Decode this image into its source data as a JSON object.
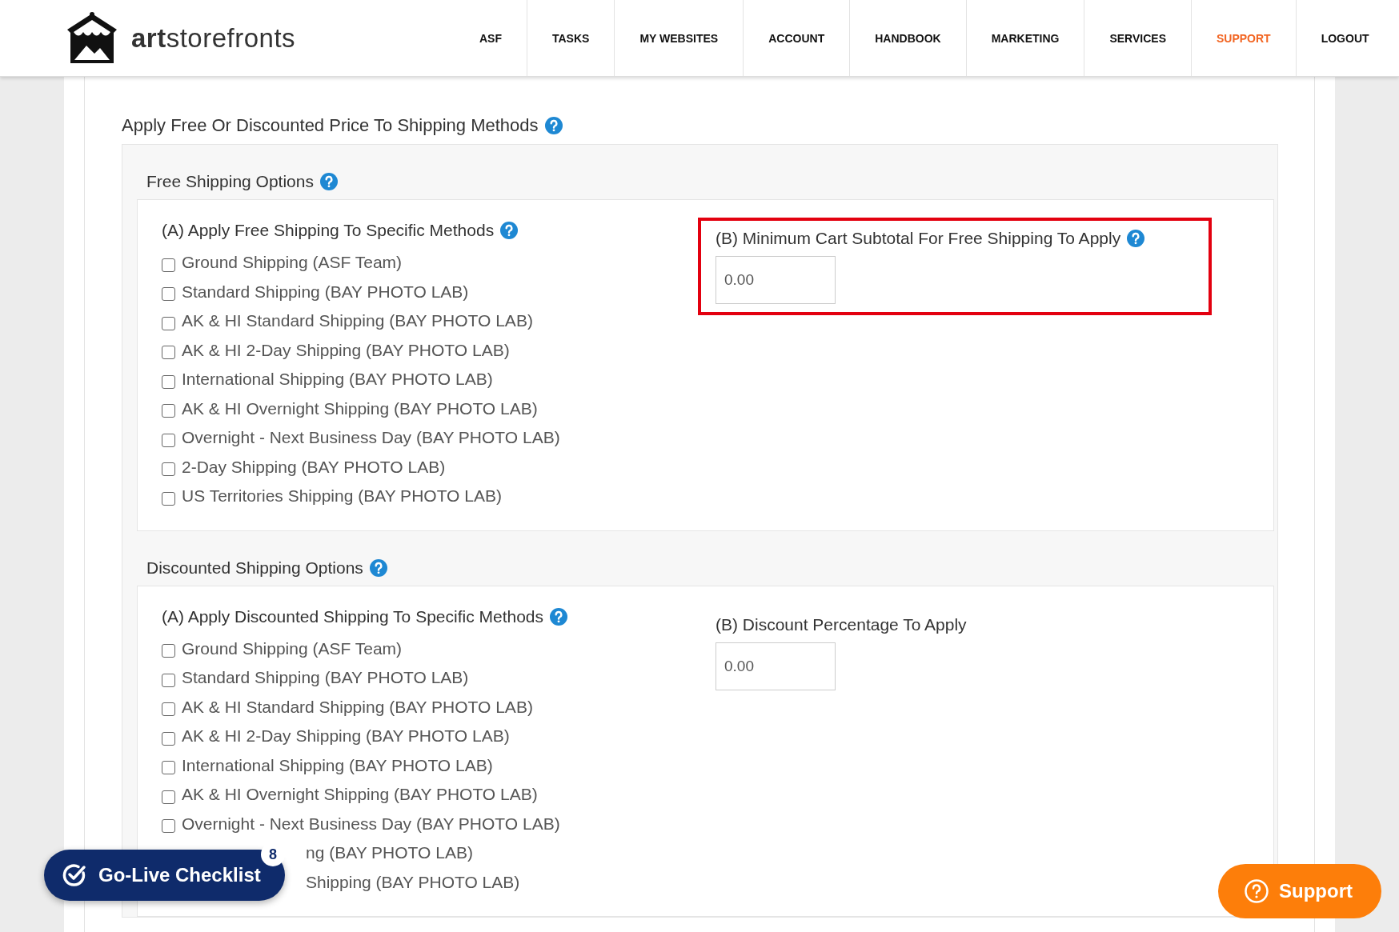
{
  "header": {
    "logo": "**art**storefronts",
    "nav": [
      {
        "label": "ASF",
        "selected": false
      },
      {
        "label": "TASKS",
        "selected": false
      },
      {
        "label": "MY WEBSITES",
        "selected": false
      },
      {
        "label": "ACCOUNT",
        "selected": false
      },
      {
        "label": "HANDBOOK",
        "selected": false
      },
      {
        "label": "MARKETING",
        "selected": false
      },
      {
        "label": "SERVICES",
        "selected": false
      },
      {
        "label": "SUPPORT",
        "selected": true
      },
      {
        "label": "LOGOUT",
        "selected": false
      }
    ]
  },
  "page_title": {
    "text": "Apply Free Or Discounted Price To Shipping Methods",
    "help": true
  },
  "sections": [
    {
      "title": "Free Shipping Options",
      "help": true,
      "column_a": {
        "title": "(A) Apply Free Shipping To Specific Methods",
        "help": true,
        "options": [
          {
            "label": "Ground Shipping (ASF Team)",
            "checked": false
          },
          {
            "label": "Standard Shipping (BAY PHOTO LAB)",
            "checked": false
          },
          {
            "label": "AK & HI Standard Shipping (BAY PHOTO LAB)",
            "checked": false
          },
          {
            "label": "AK & HI 2-Day Shipping (BAY PHOTO LAB)",
            "checked": false
          },
          {
            "label": "International Shipping (BAY PHOTO LAB)",
            "checked": false
          },
          {
            "label": "AK & HI Overnight Shipping (BAY PHOTO LAB)",
            "checked": false
          },
          {
            "label": "Overnight - Next Business Day (BAY PHOTO LAB)",
            "checked": false
          },
          {
            "label": "2-Day Shipping (BAY PHOTO LAB)",
            "checked": false
          },
          {
            "label": "US Territories Shipping (BAY PHOTO LAB)",
            "checked": false
          }
        ]
      },
      "column_b": {
        "title": "(B) Minimum Cart Subtotal For Free Shipping To Apply",
        "help": true,
        "value": "0.00",
        "highlighted": true
      }
    },
    {
      "title": "Discounted Shipping Options",
      "help": true,
      "column_a": {
        "title": "(A) Apply Discounted Shipping To Specific Methods",
        "help": true,
        "options": [
          {
            "label": "Ground Shipping (ASF Team)",
            "checked": false
          },
          {
            "label": "Standard Shipping (BAY PHOTO LAB)",
            "checked": false
          },
          {
            "label": "AK & HI Standard Shipping (BAY PHOTO LAB)",
            "checked": false
          },
          {
            "label": "AK & HI 2-Day Shipping (BAY PHOTO LAB)",
            "checked": false
          },
          {
            "label": "International Shipping (BAY PHOTO LAB)",
            "checked": false
          },
          {
            "label": "AK & HI Overnight Shipping (BAY PHOTO LAB)",
            "checked": false
          },
          {
            "label": "Overnight - Next Business Day (BAY PHOTO LAB)",
            "checked": false
          },
          {
            "kind": "partial",
            "label": "ng (BAY PHOTO LAB)"
          },
          {
            "kind": "partial",
            "label": "Shipping (BAY PHOTO LAB)"
          }
        ]
      },
      "column_b": {
        "title": "(B) Discount Percentage To Apply",
        "value": "0.00",
        "highlighted": false
      }
    }
  ],
  "checklist_button": {
    "label": "Go-Live Checklist",
    "count": "8"
  },
  "support_button": {
    "label": "Support"
  }
}
